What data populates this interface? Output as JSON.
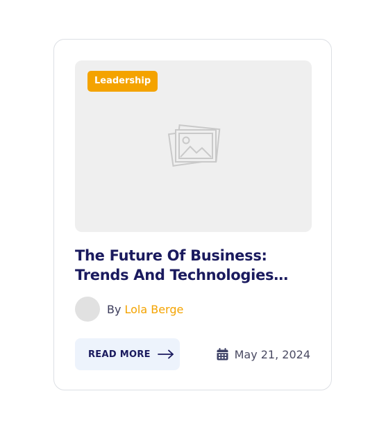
{
  "post": {
    "category": "Leadership",
    "title": "The Future Of Business: Trends And Technologies Shaping The Next Decade",
    "author_prefix": "By",
    "author_name": "Lola Berge",
    "read_more_label": "READ MORE",
    "date": "May 21, 2024",
    "thumbnail_icon": "image-placeholder-icon",
    "avatar_icon": "avatar-placeholder",
    "arrow_icon": "arrow-right-icon",
    "date_icon": "calendar-icon"
  },
  "colors": {
    "accent": "#f4a300",
    "title": "#1a1a5e",
    "button_bg": "#edf3fc",
    "thumbnail_bg": "#efefef",
    "border": "#dcdfe4"
  }
}
